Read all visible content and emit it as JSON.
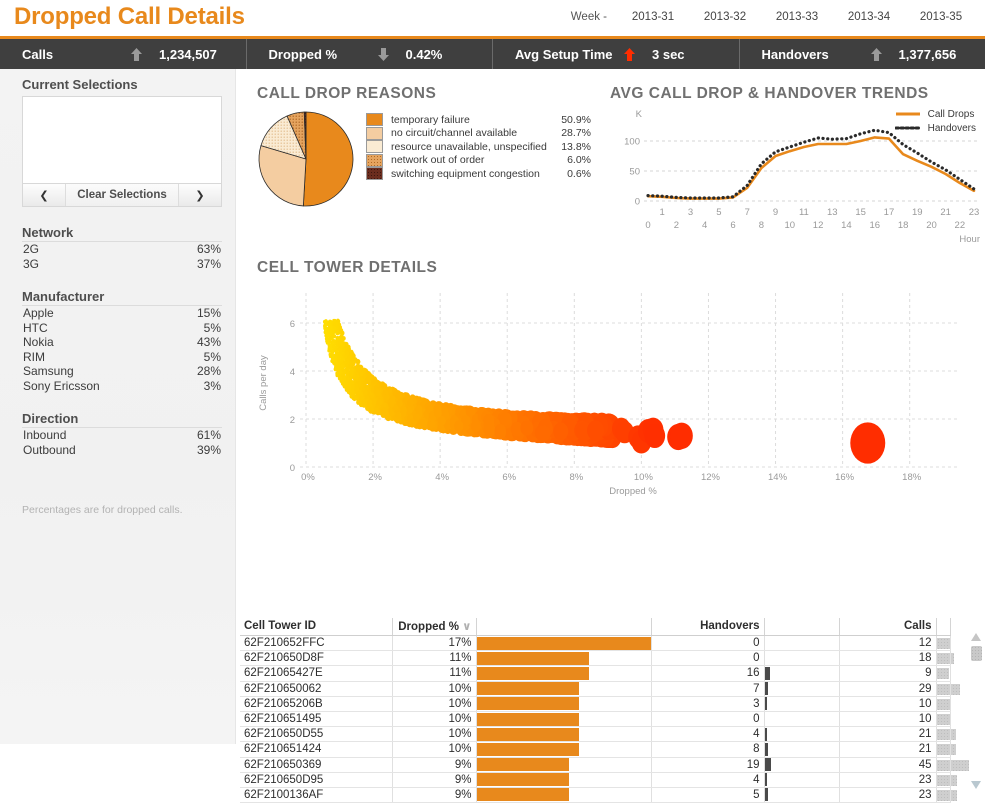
{
  "header": {
    "title": "Dropped Call Details",
    "week_label": "Week -",
    "weeks": [
      "2013-31",
      "2013-32",
      "2013-33",
      "2013-34",
      "2013-35"
    ]
  },
  "kpis": [
    {
      "name": "Calls",
      "value": "1,234,507",
      "trend": "up",
      "trend_color": "#9a9a9a"
    },
    {
      "name": "Dropped %",
      "value": "0.42%",
      "trend": "down",
      "trend_color": "#9a9a9a"
    },
    {
      "name": "Avg Setup Time",
      "value": "3 sec",
      "trend": "up",
      "trend_color": "#FF2D00"
    },
    {
      "name": "Handovers",
      "value": "1,377,656",
      "trend": "up",
      "trend_color": "#9a9a9a"
    }
  ],
  "sidebar": {
    "current_selections_title": "Current Selections",
    "prev_label": "❮",
    "clear_label": "Clear Selections",
    "next_label": "❯",
    "blocks": [
      {
        "title": "Network",
        "rows": [
          {
            "label": "2G",
            "pct": "63%"
          },
          {
            "label": "3G",
            "pct": "37%"
          }
        ]
      },
      {
        "title": "Manufacturer",
        "rows": [
          {
            "label": "Apple",
            "pct": "15%"
          },
          {
            "label": "HTC",
            "pct": "5%"
          },
          {
            "label": "Nokia",
            "pct": "43%"
          },
          {
            "label": "RIM",
            "pct": "5%"
          },
          {
            "label": "Samsung",
            "pct": "28%"
          },
          {
            "label": "Sony Ericsson",
            "pct": "3%"
          }
        ]
      },
      {
        "title": "Direction",
        "rows": [
          {
            "label": "Inbound",
            "pct": "61%"
          },
          {
            "label": "Outbound",
            "pct": "39%"
          }
        ]
      }
    ],
    "note": "Percentages are for dropped calls."
  },
  "panels": {
    "pie_title": "CALL DROP REASONS",
    "trend_title": "AVG CALL DROP & HANDOVER TRENDS",
    "scatter_title": "CELL TOWER DETAILS"
  },
  "chart_data": [
    {
      "type": "pie",
      "title": "CALL DROP REASONS",
      "legend_position": "right",
      "categories": [
        "temporary failure",
        "no circuit/channel available",
        "resource unavailable, unspecified",
        "network out of order",
        "switching equipment congestion"
      ],
      "values": [
        50.9,
        28.7,
        13.8,
        6.0,
        0.6
      ],
      "value_labels": [
        "50.9%",
        "28.7%",
        "13.8%",
        "6.0%",
        "0.6%"
      ],
      "colors": [
        "#E8891C",
        "#F4CDA1",
        "#FAEBD3",
        "#E5A45F",
        "#6B2D1E"
      ]
    },
    {
      "type": "line",
      "title": "AVG CALL DROP & HANDOVER TRENDS",
      "xlabel": "Hour",
      "ylabel": "K",
      "xlim": [
        0,
        23
      ],
      "ylim": [
        0,
        130
      ],
      "yticks": [
        0,
        50,
        100
      ],
      "ytick_labels": [
        "0",
        "50",
        "100"
      ],
      "grid": true,
      "x": [
        0,
        1,
        2,
        3,
        4,
        5,
        6,
        7,
        8,
        9,
        10,
        11,
        12,
        13,
        14,
        15,
        16,
        17,
        18,
        19,
        20,
        21,
        22,
        23
      ],
      "series": [
        {
          "name": "Call Drops",
          "color": "#E8891C",
          "style": "solid",
          "values": [
            8,
            7,
            5,
            4,
            4,
            4,
            6,
            22,
            55,
            75,
            83,
            90,
            95,
            95,
            95,
            100,
            106,
            104,
            78,
            67,
            57,
            45,
            30,
            17
          ]
        },
        {
          "name": "Handovers",
          "color": "#2a2a2a",
          "style": "dotted",
          "values": [
            9,
            8,
            6,
            5,
            5,
            5,
            7,
            26,
            62,
            82,
            90,
            98,
            105,
            103,
            104,
            112,
            118,
            114,
            94,
            80,
            65,
            52,
            36,
            20
          ]
        }
      ]
    },
    {
      "type": "scatter",
      "title": "CELL TOWER DETAILS",
      "xlabel": "Dropped %",
      "ylabel": "Calls per day",
      "xlim": [
        0,
        19.5
      ],
      "ylim": [
        0,
        7
      ],
      "xticks": [
        0,
        2,
        4,
        6,
        8,
        10,
        12,
        14,
        16,
        18
      ],
      "xtick_labels": [
        "0%",
        "2%",
        "4%",
        "6%",
        "8%",
        "10%",
        "12%",
        "14%",
        "16%",
        "18%"
      ],
      "yticks": [
        0,
        2,
        4,
        6
      ],
      "ytick_labels": [
        "0",
        "2",
        "4",
        "6"
      ],
      "grid": true,
      "colormap": [
        "#FFE800",
        "#FF8A00",
        "#FF2D00"
      ],
      "note": "bubble size grows with dropped %; color ramps yellow to red"
    },
    {
      "type": "table",
      "title": "Cell Tower Details table",
      "columns": [
        "Cell Tower ID",
        "Dropped %",
        "Handovers",
        "Calls"
      ],
      "sort_column": "Dropped %",
      "sort_direction": "descending",
      "rows": [
        {
          "id": "62F210652FFC",
          "dropped": "17%",
          "dropped_val": 17,
          "handovers": "0",
          "handovers_val": 0,
          "calls": "12",
          "calls_val": 12
        },
        {
          "id": "62F210650D8F",
          "dropped": "11%",
          "dropped_val": 11,
          "handovers": "0",
          "handovers_val": 0,
          "calls": "18",
          "calls_val": 18
        },
        {
          "id": "62F21065427E",
          "dropped": "11%",
          "dropped_val": 11,
          "handovers": "16",
          "handovers_val": 16,
          "calls": "9",
          "calls_val": 9
        },
        {
          "id": "62F210650062",
          "dropped": "10%",
          "dropped_val": 10,
          "handovers": "7",
          "handovers_val": 7,
          "calls": "29",
          "calls_val": 29
        },
        {
          "id": "62F21065206B",
          "dropped": "10%",
          "dropped_val": 10,
          "handovers": "3",
          "handovers_val": 3,
          "calls": "10",
          "calls_val": 10
        },
        {
          "id": "62F210651495",
          "dropped": "10%",
          "dropped_val": 10,
          "handovers": "0",
          "handovers_val": 0,
          "calls": "10",
          "calls_val": 10
        },
        {
          "id": "62F210650D55",
          "dropped": "10%",
          "dropped_val": 10,
          "handovers": "4",
          "handovers_val": 4,
          "calls": "21",
          "calls_val": 21
        },
        {
          "id": "62F210651424",
          "dropped": "10%",
          "dropped_val": 10,
          "handovers": "8",
          "handovers_val": 8,
          "calls": "21",
          "calls_val": 21
        },
        {
          "id": "62F210650369",
          "dropped": "9%",
          "dropped_val": 9,
          "handovers": "19",
          "handovers_val": 19,
          "calls": "45",
          "calls_val": 45
        },
        {
          "id": "62F210650D95",
          "dropped": "9%",
          "dropped_val": 9,
          "handovers": "4",
          "handovers_val": 4,
          "calls": "23",
          "calls_val": 23
        },
        {
          "id": "62F2100136AF",
          "dropped": "9%",
          "dropped_val": 9,
          "handovers": "5",
          "handovers_val": 5,
          "calls": "23",
          "calls_val": 23
        }
      ]
    }
  ]
}
